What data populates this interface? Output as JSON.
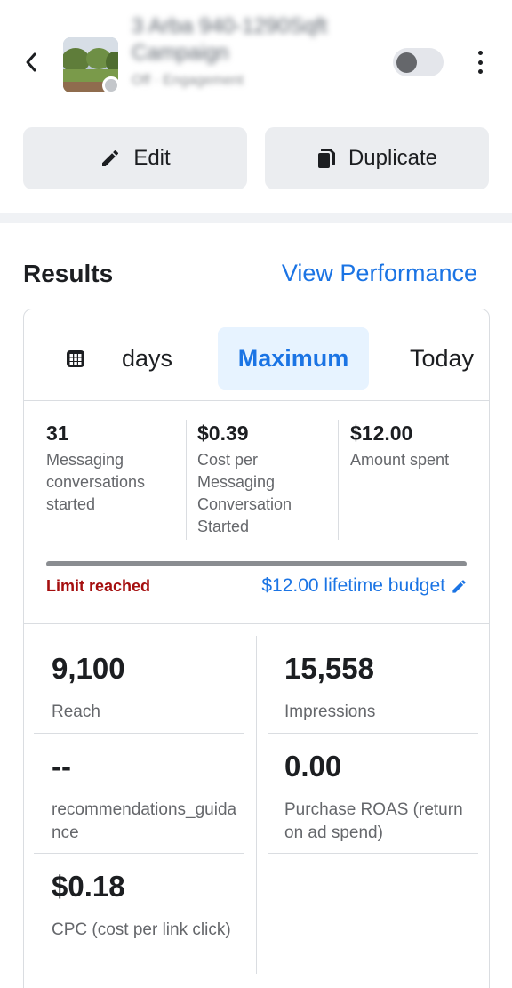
{
  "header": {
    "campaign_title": "3 Arba 940-1290Sqft Campaign",
    "campaign_subtitle": "Off · Engagement",
    "toggle_state": "off"
  },
  "actions": {
    "edit_label": "Edit",
    "duplicate_label": "Duplicate"
  },
  "results": {
    "title": "Results",
    "view_performance": "View Performance"
  },
  "tabs": [
    {
      "label": "days"
    },
    {
      "label": "Maximum",
      "selected": true
    },
    {
      "label": "Today"
    }
  ],
  "summary": [
    {
      "value": "31",
      "label": "Messaging conversations started"
    },
    {
      "value": "$0.39",
      "label": "Cost per Messaging Conversation Started"
    },
    {
      "value": "$12.00",
      "label": "Amount spent"
    }
  ],
  "budget": {
    "progress_percent": 100,
    "limit_text": "Limit reached",
    "budget_text": "$12.00 lifetime budget"
  },
  "metrics": [
    {
      "value": "9,100",
      "label": "Reach"
    },
    {
      "value": "15,558",
      "label": "Impressions"
    },
    {
      "value": "--",
      "label": "recommendations_guidance"
    },
    {
      "value": "0.00",
      "label": "Purchase ROAS (return on ad spend)"
    },
    {
      "value": "$0.18",
      "label": "CPC (cost per link click)"
    }
  ],
  "colors": {
    "accent": "#1b74e4",
    "warning": "#a50f0f"
  },
  "icons": [
    "back-arrow-icon",
    "more-vertical-icon",
    "pencil-icon",
    "copy-icon",
    "calendar-icon",
    "edit-pencil-icon"
  ]
}
